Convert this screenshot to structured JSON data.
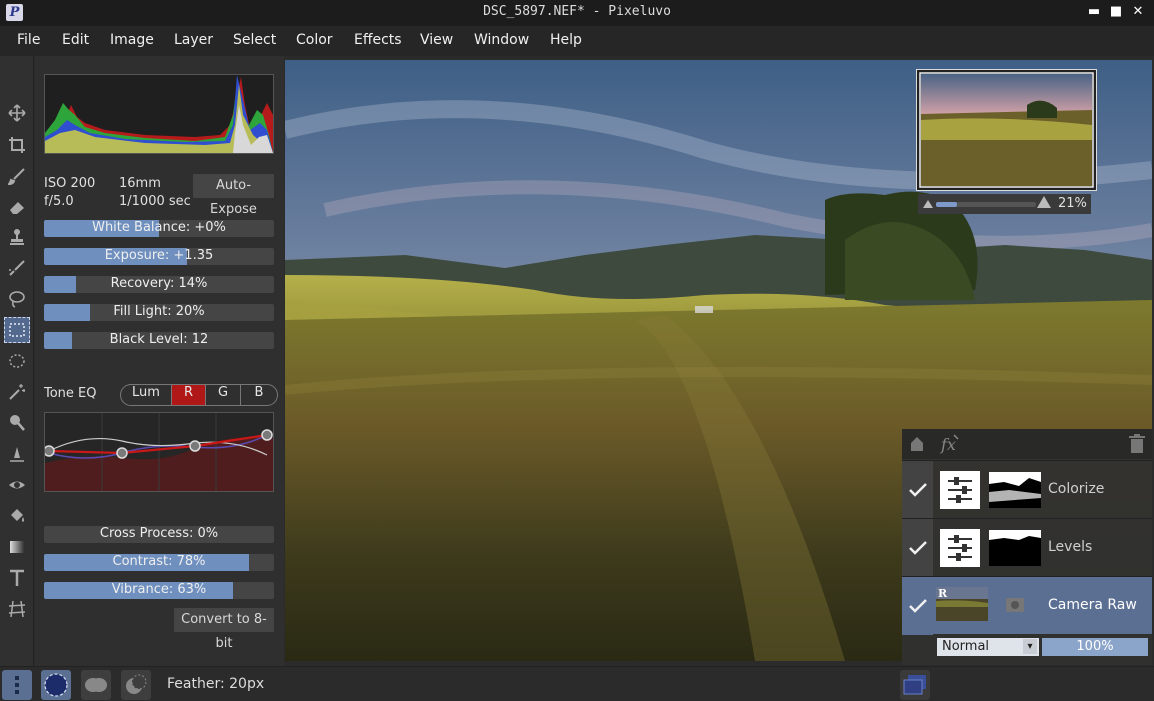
{
  "window": {
    "title": "DSC_5897.NEF* - Pixeluvo",
    "minimize": "▬",
    "maximize": "■",
    "close": "✕",
    "app_icon": "P"
  },
  "menu": [
    "File",
    "Edit",
    "Image",
    "Layer",
    "Select",
    "Color",
    "Effects",
    "View",
    "Window",
    "Help"
  ],
  "tools": [
    "move-icon",
    "crop-icon",
    "brush-icon",
    "eraser-icon",
    "clone-stamp-icon",
    "smudge-icon",
    "lasso-icon",
    "rect-select-icon",
    "ellipse-select-icon",
    "magic-wand-icon",
    "dodge-icon",
    "sharpen-icon",
    "red-eye-icon",
    "fill-icon",
    "gradient-icon",
    "text-icon",
    "perspective-icon"
  ],
  "camera": {
    "iso": "ISO 200",
    "focal": "16mm",
    "aperture": "f/5.0",
    "shutter": "1/1000 sec",
    "auto_expose": "Auto-Expose"
  },
  "sliders": {
    "white_balance": {
      "label": "White Balance: +0%",
      "fraction": 0.5
    },
    "exposure": {
      "label": "Exposure: +1.35",
      "fraction": 0.62
    },
    "recovery": {
      "label": "Recovery: 14%",
      "fraction": 0.14
    },
    "fill_light": {
      "label": "Fill Light: 20%",
      "fraction": 0.2
    },
    "black_level": {
      "label": "Black Level: 12",
      "fraction": 0.12
    },
    "cross_process": {
      "label": "Cross Process: 0%",
      "fraction": 0.0
    },
    "contrast": {
      "label": "Contrast: 78%",
      "fraction": 0.89
    },
    "vibrance": {
      "label": "Vibrance: 63%",
      "fraction": 0.82
    }
  },
  "tone_eq": {
    "label": "Tone EQ",
    "channels": [
      "Lum",
      "R",
      "G",
      "B"
    ],
    "active": "R"
  },
  "convert_btn": "Convert to 8-bit",
  "navigator": {
    "zoom": "21%"
  },
  "layers": [
    {
      "name": "Colorize",
      "visible": true,
      "selected": false
    },
    {
      "name": "Levels",
      "visible": true,
      "selected": false
    },
    {
      "name": "Camera Raw",
      "visible": true,
      "selected": true,
      "badge": "R"
    }
  ],
  "blend_mode": "Normal",
  "opacity": "100%",
  "feather": "Feather: 20px",
  "colors": {
    "accent": "#6f90bf",
    "selected": "#5b6f93",
    "active_channel": "#b01818"
  }
}
